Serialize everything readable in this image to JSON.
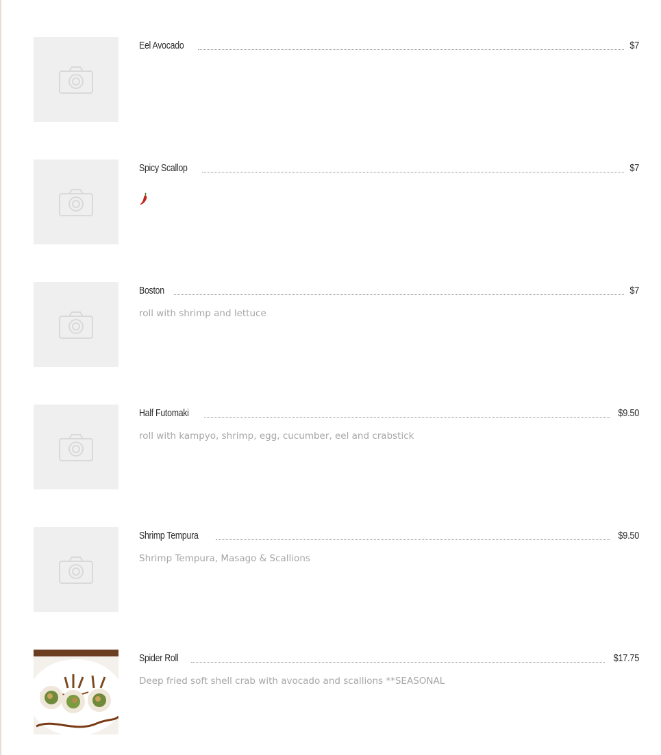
{
  "menu": {
    "items": [
      {
        "name": "Eel Avocado",
        "price": "$7",
        "description": "",
        "spicy": false,
        "image": "camera-placeholder-icon"
      },
      {
        "name": "Spicy Scallop",
        "price": "$7",
        "description": "",
        "spicy": true,
        "image": "camera-placeholder-icon"
      },
      {
        "name": "Boston",
        "price": "$7",
        "description": "roll with shrimp and lettuce",
        "spicy": false,
        "image": "camera-placeholder-icon"
      },
      {
        "name": "Half Futomaki",
        "price": "$9.50",
        "description": "roll with kampyo, shrimp, egg, cucumber, eel and crabstick",
        "spicy": false,
        "image": "camera-placeholder-icon"
      },
      {
        "name": "Shrimp Tempura",
        "price": "$9.50",
        "description": "Shrimp Tempura, Masago & Scallions",
        "spicy": false,
        "image": "camera-placeholder-icon"
      },
      {
        "name": "Spider Roll",
        "price": "$17.75",
        "description": "Deep fried soft shell crab with avocado and scallions **SEASONAL",
        "spicy": false,
        "image": "spider-roll-photo"
      }
    ]
  },
  "colors": {
    "placeholder_bg": "#efefef",
    "placeholder_icon": "#d9d9d9",
    "item_name": "#2b2b2b",
    "description": "#a6a6a6",
    "spicy_icon": "#c0271d",
    "left_rule": "#e6ded2"
  }
}
